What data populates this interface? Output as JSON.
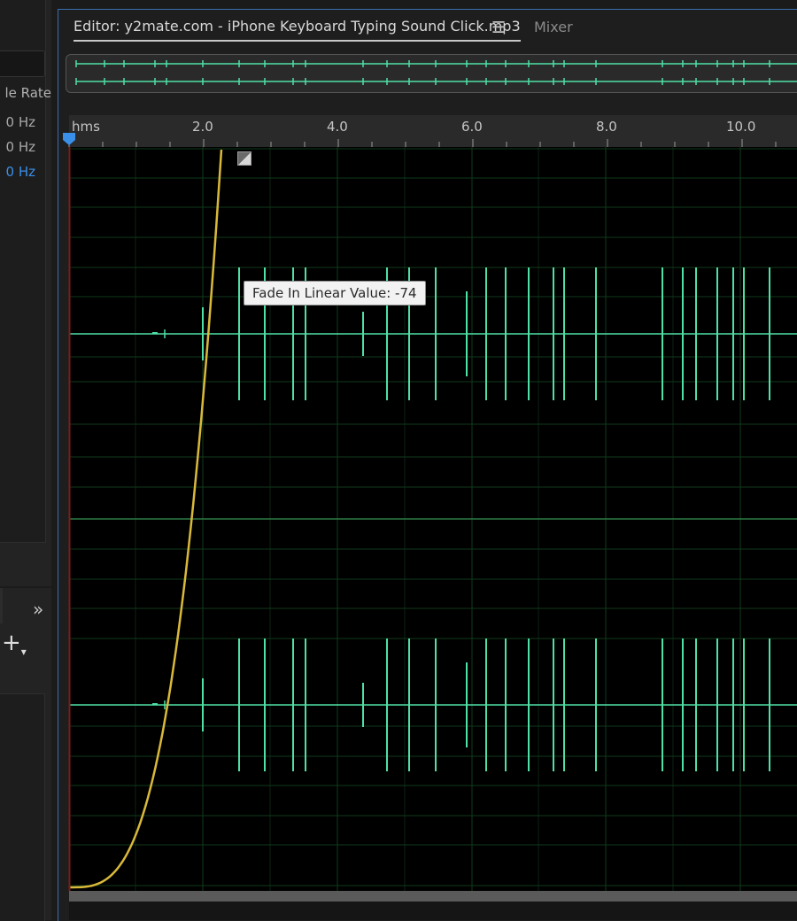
{
  "left_panel": {
    "column_header": "le Rate",
    "sample_rates": [
      {
        "text": "0 Hz",
        "selected": false
      },
      {
        "text": "0 Hz",
        "selected": false
      },
      {
        "text": "0 Hz",
        "selected": true
      }
    ],
    "expand_icon": "double-chevron-right-icon",
    "add_icon": "plus-dropdown-icon"
  },
  "editor": {
    "tab_label": "Editor: y2mate.com - iPhone Keyboard Typing Sound Click.mp3",
    "menu_icon": "hamburger-menu-icon",
    "mixer_label": "Mixer",
    "ruler_labels": [
      "hms",
      "2.0",
      "4.0",
      "6.0",
      "8.0",
      "10.0"
    ],
    "tooltip": "Fade In Linear Value: -74"
  },
  "colors": {
    "waveform": "#4fe0a6",
    "fade_curve": "#d9b93a",
    "selection_accent": "#3a8fe8",
    "grid": "#0f3a1a",
    "selected_text": "#3a8fe8"
  }
}
